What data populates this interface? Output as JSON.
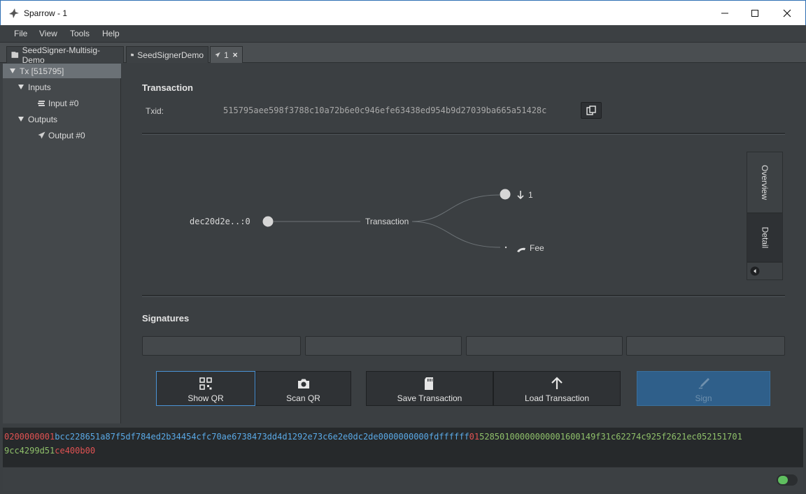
{
  "window": {
    "title": "Sparrow - 1"
  },
  "menu": [
    "File",
    "View",
    "Tools",
    "Help"
  ],
  "tabs": [
    {
      "label": "SeedSigner-Multisig-Demo",
      "icon": "wallet-icon"
    },
    {
      "label": "SeedSignerDemo",
      "icon": "wallet-icon"
    },
    {
      "label": "1",
      "icon": "send-icon",
      "active": true
    }
  ],
  "tree": {
    "root": "Tx [515795]",
    "inputs_label": "Inputs",
    "input_item": "Input #0",
    "outputs_label": "Outputs",
    "output_item": "Output #0"
  },
  "transaction": {
    "title": "Transaction",
    "txid_label": "Txid:",
    "txid": "515795aee598f3788c10a72b6e0c946efe63438ed954b9d27039ba665a51428c"
  },
  "diagram": {
    "input_label": "dec20d2e..:0",
    "center_label": "Transaction",
    "output_label": "1",
    "fee_label": "Fee",
    "side_tabs": [
      "Overview",
      "Detail"
    ]
  },
  "signatures": {
    "title": "Signatures"
  },
  "buttons": {
    "show_qr": "Show QR",
    "scan_qr": "Scan QR",
    "save_tx": "Save Transaction",
    "load_tx": "Load Transaction",
    "sign": "Sign"
  },
  "hex": {
    "line1": [
      {
        "text": "02000000",
        "color": "#e05252"
      },
      {
        "text": "01",
        "color": "#e05252"
      },
      {
        "text": "bcc228651a87f5df784ed2b34454cfc70ae6738473dd4d1292e73c6e2e0dc2de00000000",
        "color": "#5aa9e6"
      },
      {
        "text": "00",
        "color": "#5aa9e6"
      },
      {
        "text": "fdffffff",
        "color": "#5aa9e6"
      },
      {
        "text": "01",
        "color": "#e05252"
      },
      {
        "text": "52850100000000001600149f31c62274c925f2621ec052151701",
        "color": "#8fc06a"
      }
    ],
    "line2": [
      {
        "text": "9cc4299d51",
        "color": "#8fc06a"
      },
      {
        "text": "ce400b00",
        "color": "#e05252"
      }
    ]
  },
  "colors": {
    "accent": "#4b93d6",
    "toggle_on": "#5fbf5f"
  }
}
